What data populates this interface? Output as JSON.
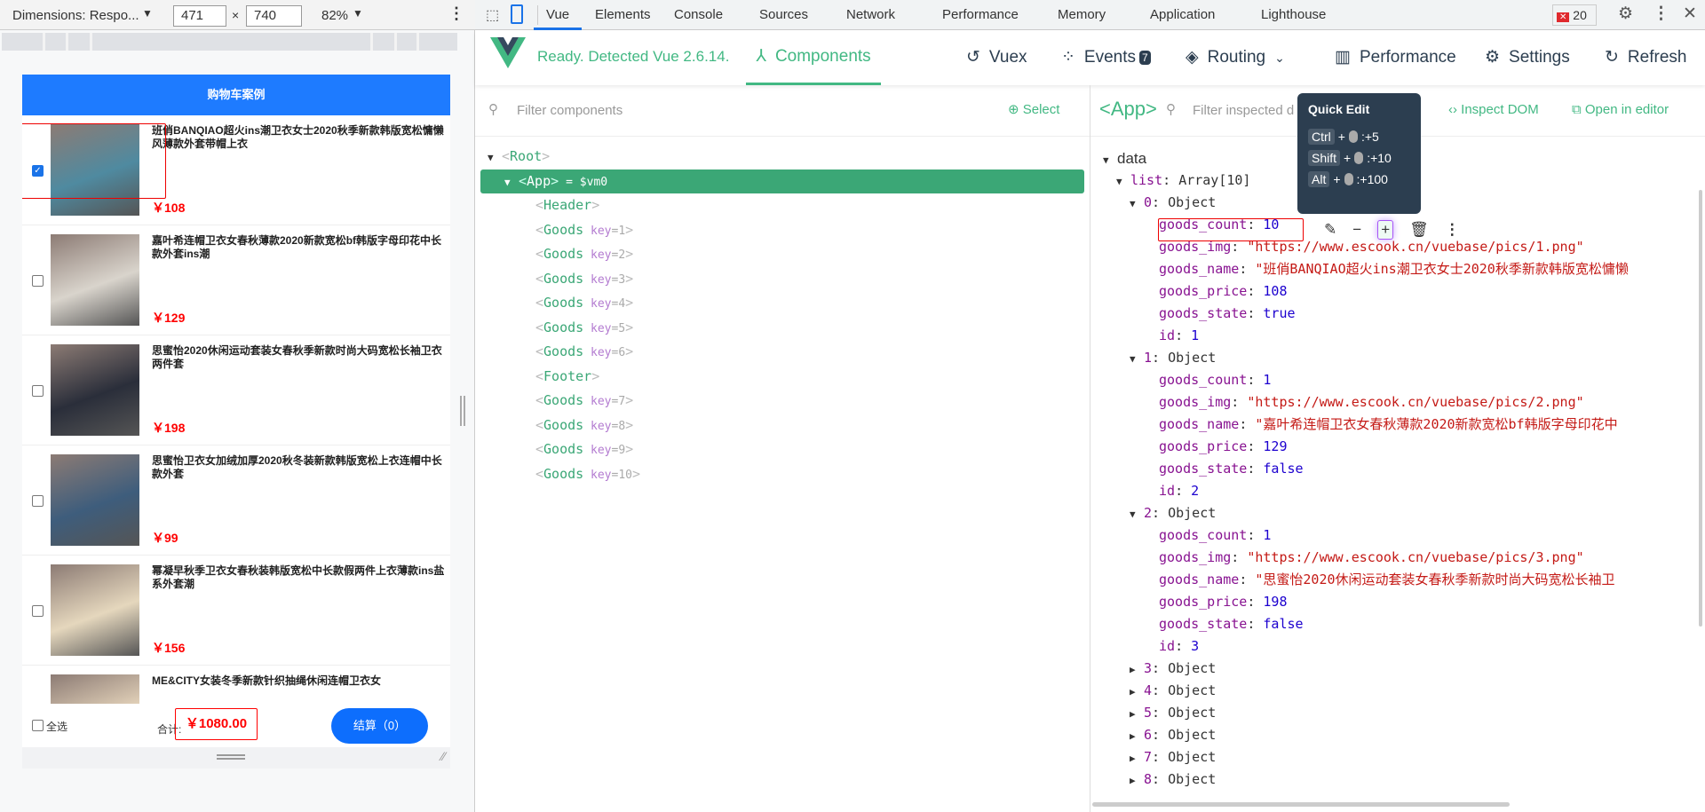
{
  "device_toolbar": {
    "dimensions_label": "Dimensions: Respo...",
    "width": "471",
    "height": "740",
    "times": "×",
    "zoom": "82%"
  },
  "app": {
    "title": "购物车案例",
    "items": [
      {
        "name": "班俏BANQIAO超火ins潮卫衣女士2020秋季新款韩版宽松慵懒风薄款外套带帽上衣",
        "price": "￥108",
        "checked": true,
        "color": "#4f8aa0"
      },
      {
        "name": "嘉叶希连帽卫衣女春秋薄款2020新款宽松bf韩版字母印花中长款外套ins潮",
        "price": "￥129",
        "checked": false,
        "color": "#d9d4cc"
      },
      {
        "name": "思蜜怡2020休闲运动套装女春秋季新款时尚大码宽松长袖卫衣两件套",
        "price": "￥198",
        "checked": false,
        "color": "#2a2e3a"
      },
      {
        "name": "思蜜怡卫衣女加绒加厚2020秋冬装新款韩版宽松上衣连帽中长款外套",
        "price": "￥99",
        "checked": false,
        "color": "#3e5d7c"
      },
      {
        "name": "幂凝早秋季卫衣女春秋装韩版宽松中长款假两件上衣薄款ins盐系外套潮",
        "price": "￥156",
        "checked": false,
        "color": "#e5d7bd"
      },
      {
        "name": "ME&CITY女装冬季新款针织抽绳休闲连帽卫衣女",
        "price": "",
        "checked": false,
        "color": "#ead9bf"
      }
    ],
    "footer": {
      "select_all": "全选",
      "total_label": "合计:",
      "total": "￥1080.00",
      "checkout": "结算（0）"
    }
  },
  "devtools_tabs": [
    "Vue",
    "Elements",
    "Console",
    "Sources",
    "Network",
    "Performance",
    "Memory",
    "Application",
    "Lighthouse"
  ],
  "error_count": "20",
  "vue": {
    "status": "Ready. Detected Vue 2.6.14.",
    "nav": {
      "components": "Components",
      "vuex": "Vuex",
      "events": "Events",
      "events_badge": "7",
      "routing": "Routing",
      "performance": "Performance",
      "settings": "Settings",
      "refresh": "Refresh"
    },
    "filter_components": "Filter components",
    "select": "Select",
    "inspected": "<App>",
    "filter_inspected": "Filter inspected data",
    "inspect_dom": "Inspect DOM",
    "open_editor": "Open in editor",
    "tree": [
      {
        "lvl": 0,
        "name": "Root",
        "key": ""
      },
      {
        "lvl": 1,
        "name": "App",
        "key": "",
        "suffix": "= $vm0",
        "selected": true
      },
      {
        "lvl": 2,
        "name": "Header",
        "key": ""
      },
      {
        "lvl": 2,
        "name": "Goods",
        "key": "1"
      },
      {
        "lvl": 2,
        "name": "Goods",
        "key": "2"
      },
      {
        "lvl": 2,
        "name": "Goods",
        "key": "3"
      },
      {
        "lvl": 2,
        "name": "Goods",
        "key": "4"
      },
      {
        "lvl": 2,
        "name": "Goods",
        "key": "5"
      },
      {
        "lvl": 2,
        "name": "Goods",
        "key": "6"
      },
      {
        "lvl": 2,
        "name": "Footer",
        "key": ""
      },
      {
        "lvl": 2,
        "name": "Goods",
        "key": "7"
      },
      {
        "lvl": 2,
        "name": "Goods",
        "key": "8"
      },
      {
        "lvl": 2,
        "name": "Goods",
        "key": "9"
      },
      {
        "lvl": 2,
        "name": "Goods",
        "key": "10"
      }
    ],
    "data_rows": [
      {
        "lvl": 0,
        "tri": "▼",
        "k": "data",
        "v": ""
      },
      {
        "lvl": 1,
        "tri": "▼",
        "k": "list",
        "v": "Array[10]",
        "t": "obj"
      },
      {
        "lvl": 2,
        "tri": "▼",
        "k": "0",
        "v": "Object",
        "t": "obj"
      },
      {
        "lvl": 3,
        "k": "goods_count",
        "v": "10",
        "t": "num"
      },
      {
        "lvl": 3,
        "k": "goods_img",
        "v": "\"https://www.escook.cn/vuebase/pics/1.png\"",
        "t": "str"
      },
      {
        "lvl": 3,
        "k": "goods_name",
        "v": "\"班俏BANQIAO超火ins潮卫衣女士2020秋季新款韩版宽松慵懒",
        "t": "str"
      },
      {
        "lvl": 3,
        "k": "goods_price",
        "v": "108",
        "t": "num"
      },
      {
        "lvl": 3,
        "k": "goods_state",
        "v": "true",
        "t": "num"
      },
      {
        "lvl": 3,
        "k": "id",
        "v": "1",
        "t": "num"
      },
      {
        "lvl": 2,
        "tri": "▼",
        "k": "1",
        "v": "Object",
        "t": "obj"
      },
      {
        "lvl": 3,
        "k": "goods_count",
        "v": "1",
        "t": "num"
      },
      {
        "lvl": 3,
        "k": "goods_img",
        "v": "\"https://www.escook.cn/vuebase/pics/2.png\"",
        "t": "str"
      },
      {
        "lvl": 3,
        "k": "goods_name",
        "v": "\"嘉叶希连帽卫衣女春秋薄款2020新款宽松bf韩版字母印花中",
        "t": "str"
      },
      {
        "lvl": 3,
        "k": "goods_price",
        "v": "129",
        "t": "num"
      },
      {
        "lvl": 3,
        "k": "goods_state",
        "v": "false",
        "t": "num"
      },
      {
        "lvl": 3,
        "k": "id",
        "v": "2",
        "t": "num"
      },
      {
        "lvl": 2,
        "tri": "▼",
        "k": "2",
        "v": "Object",
        "t": "obj"
      },
      {
        "lvl": 3,
        "k": "goods_count",
        "v": "1",
        "t": "num"
      },
      {
        "lvl": 3,
        "k": "goods_img",
        "v": "\"https://www.escook.cn/vuebase/pics/3.png\"",
        "t": "str"
      },
      {
        "lvl": 3,
        "k": "goods_name",
        "v": "\"思蜜怡2020休闲运动套装女春秋季新款时尚大码宽松长袖卫",
        "t": "str"
      },
      {
        "lvl": 3,
        "k": "goods_price",
        "v": "198",
        "t": "num"
      },
      {
        "lvl": 3,
        "k": "goods_state",
        "v": "false",
        "t": "num"
      },
      {
        "lvl": 3,
        "k": "id",
        "v": "3",
        "t": "num"
      },
      {
        "lvl": 2,
        "tri": "▶",
        "k": "3",
        "v": "Object",
        "t": "obj"
      },
      {
        "lvl": 2,
        "tri": "▶",
        "k": "4",
        "v": "Object",
        "t": "obj"
      },
      {
        "lvl": 2,
        "tri": "▶",
        "k": "5",
        "v": "Object",
        "t": "obj"
      },
      {
        "lvl": 2,
        "tri": "▶",
        "k": "6",
        "v": "Object",
        "t": "obj"
      },
      {
        "lvl": 2,
        "tri": "▶",
        "k": "7",
        "v": "Object",
        "t": "obj"
      },
      {
        "lvl": 2,
        "tri": "▶",
        "k": "8",
        "v": "Object",
        "t": "obj"
      }
    ],
    "quick_edit": {
      "title": "Quick Edit",
      "rows": [
        {
          "key": "Ctrl",
          "val": ":+5"
        },
        {
          "key": "Shift",
          "val": ":+10"
        },
        {
          "key": "Alt",
          "val": ":+100"
        }
      ]
    }
  },
  "colors": {
    "vue_green": "#42b883",
    "header_blue": "#1e7bff",
    "price_red": "#ff0000"
  }
}
